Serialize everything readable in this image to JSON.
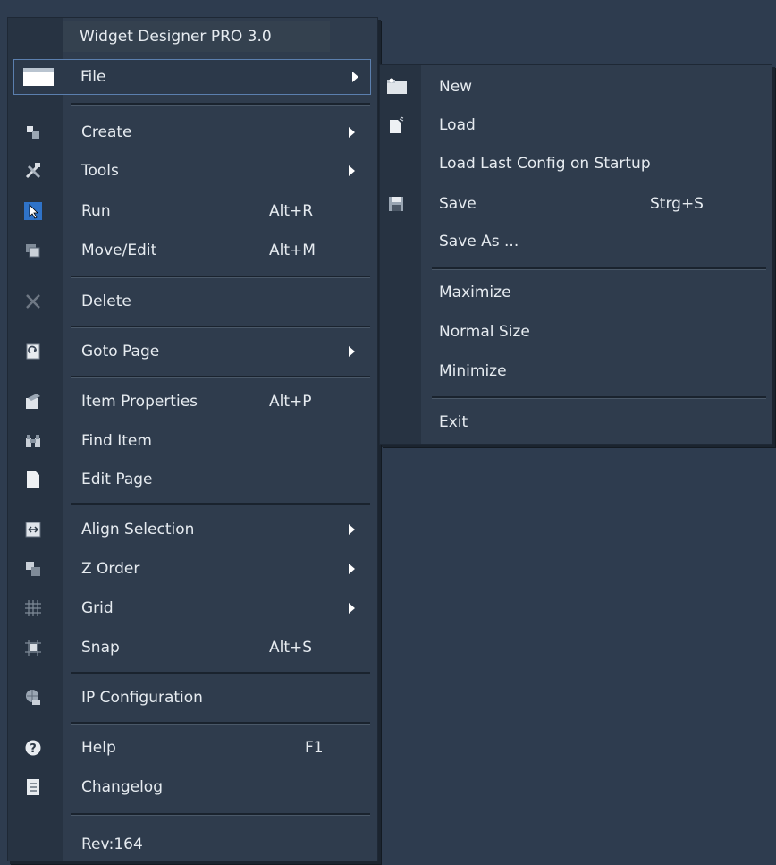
{
  "menu": {
    "title": "Widget Designer PRO 3.0",
    "file_label": "File",
    "items": [
      {
        "label": "Create",
        "shortcut": "",
        "submenu": true,
        "icon": "create-icon"
      },
      {
        "label": "Tools",
        "shortcut": "",
        "submenu": true,
        "icon": "tools-icon"
      },
      {
        "label": "Run",
        "shortcut": "Alt+R",
        "submenu": false,
        "icon": "cursor-icon"
      },
      {
        "label": "Move/Edit",
        "shortcut": "Alt+M",
        "submenu": false,
        "icon": "move-edit-icon"
      },
      {
        "label": "Delete",
        "shortcut": "",
        "submenu": false,
        "icon": "delete-icon"
      },
      {
        "label": "Goto Page",
        "shortcut": "",
        "submenu": true,
        "icon": "goto-page-icon"
      },
      {
        "label": "Item Properties",
        "shortcut": "Alt+P",
        "submenu": false,
        "icon": "properties-icon"
      },
      {
        "label": "Find Item",
        "shortcut": "",
        "submenu": false,
        "icon": "binoculars-icon"
      },
      {
        "label": "Edit Page",
        "shortcut": "",
        "submenu": false,
        "icon": "page-icon"
      },
      {
        "label": "Align Selection",
        "shortcut": "",
        "submenu": true,
        "icon": "align-icon"
      },
      {
        "label": "Z Order",
        "shortcut": "",
        "submenu": true,
        "icon": "z-order-icon"
      },
      {
        "label": "Grid",
        "shortcut": "",
        "submenu": true,
        "icon": "grid-icon"
      },
      {
        "label": "Snap",
        "shortcut": "Alt+S",
        "submenu": false,
        "icon": "snap-icon"
      },
      {
        "label": "IP Configuration",
        "shortcut": "",
        "submenu": false,
        "icon": "network-icon"
      },
      {
        "label": "Help",
        "shortcut": "F1",
        "submenu": false,
        "icon": "help-icon"
      },
      {
        "label": "Changelog",
        "shortcut": "",
        "submenu": false,
        "icon": "changelog-icon"
      }
    ],
    "revision": "Rev:164"
  },
  "file_submenu": {
    "items": [
      {
        "label": "New",
        "shortcut": "",
        "icon": "new-folder-icon"
      },
      {
        "label": "Load",
        "shortcut": "",
        "icon": "load-icon"
      },
      {
        "label": "Load Last Config on Startup",
        "shortcut": "",
        "icon": ""
      },
      {
        "label": "Save",
        "shortcut": "Strg+S",
        "icon": "save-icon"
      },
      {
        "label": "Save As ...",
        "shortcut": "",
        "icon": ""
      },
      {
        "label": "Maximize",
        "shortcut": "",
        "icon": ""
      },
      {
        "label": "Normal Size",
        "shortcut": "",
        "icon": ""
      },
      {
        "label": "Minimize",
        "shortcut": "",
        "icon": ""
      },
      {
        "label": "Exit",
        "shortcut": "",
        "icon": ""
      }
    ]
  }
}
